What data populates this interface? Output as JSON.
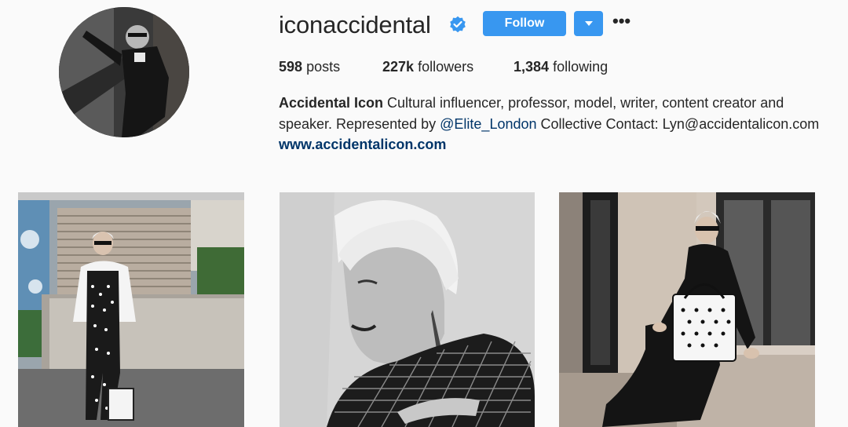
{
  "profile": {
    "username": "iconaccidental",
    "verified_icon": "verified-badge-icon",
    "follow_label": "Follow",
    "dropdown_icon": "caret-down-icon",
    "more_label": "•••",
    "stats": {
      "posts_count": "598",
      "posts_label": "posts",
      "followers_count": "227k",
      "followers_label": "followers",
      "following_count": "1,384",
      "following_label": "following"
    },
    "bio": {
      "name": "Accidental Icon",
      "text_1": " Cultural influencer, professor, model, writer, content creator and speaker. Represented by ",
      "mention": "@Elite_London",
      "text_2": " Collective Contact: Lyn@accidentalicon.com ",
      "website": "www.accidentalicon.com"
    }
  },
  "colors": {
    "accent": "#3897f0",
    "link": "#003569",
    "background": "#fafafa",
    "text": "#262626"
  },
  "posts": [
    {
      "kind": "photo"
    },
    {
      "kind": "photo"
    },
    {
      "kind": "photo"
    }
  ]
}
